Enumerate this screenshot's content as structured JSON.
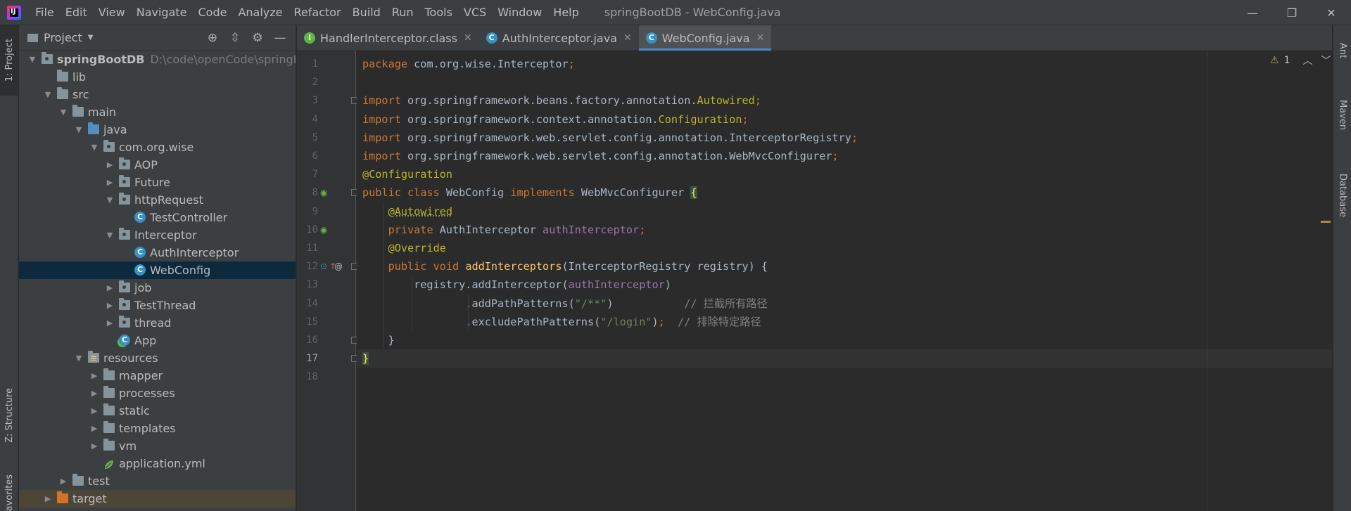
{
  "titlebar": {
    "menu": [
      "File",
      "Edit",
      "View",
      "Navigate",
      "Code",
      "Analyze",
      "Refactor",
      "Build",
      "Run",
      "Tools",
      "VCS",
      "Window",
      "Help"
    ],
    "window_title": "springBootDB - WebConfig.java",
    "minimize": "—",
    "restore": "❐",
    "close": "✕"
  },
  "left_strip": {
    "project_tab": "1: Project",
    "structure_tab": "Z: Structure",
    "favorites_tab": "avorites"
  },
  "right_strip": {
    "ant_tab": "Ant",
    "maven_tab": "Maven",
    "database_tab": "Database"
  },
  "project_panel": {
    "title": "Project",
    "tree": [
      {
        "label": "springBootDB",
        "path": "D:\\code\\openCode\\springBoot",
        "depth": 0,
        "expanded": true,
        "icon": "module-folder"
      },
      {
        "label": "lib",
        "depth": 1,
        "icon": "folder"
      },
      {
        "label": "src",
        "depth": 1,
        "expanded": true,
        "icon": "folder"
      },
      {
        "label": "main",
        "depth": 2,
        "expanded": true,
        "icon": "folder"
      },
      {
        "label": "java",
        "depth": 3,
        "expanded": true,
        "icon": "source-folder"
      },
      {
        "label": "com.org.wise",
        "depth": 4,
        "expanded": true,
        "icon": "package"
      },
      {
        "label": "AOP",
        "depth": 5,
        "expanded": false,
        "icon": "package"
      },
      {
        "label": "Future",
        "depth": 5,
        "expanded": false,
        "icon": "package"
      },
      {
        "label": "httpRequest",
        "depth": 5,
        "expanded": true,
        "icon": "package"
      },
      {
        "label": "TestController",
        "depth": 6,
        "icon": "class"
      },
      {
        "label": "Interceptor",
        "depth": 5,
        "expanded": true,
        "icon": "package"
      },
      {
        "label": "AuthInterceptor",
        "depth": 6,
        "icon": "class"
      },
      {
        "label": "WebConfig",
        "depth": 6,
        "icon": "class",
        "selected": true
      },
      {
        "label": "job",
        "depth": 5,
        "expanded": false,
        "icon": "package"
      },
      {
        "label": "TestThread",
        "depth": 5,
        "expanded": false,
        "icon": "package"
      },
      {
        "label": "thread",
        "depth": 5,
        "expanded": false,
        "icon": "package"
      },
      {
        "label": "App",
        "depth": 5,
        "icon": "spring-class"
      },
      {
        "label": "resources",
        "depth": 3,
        "expanded": true,
        "icon": "resources-folder"
      },
      {
        "label": "mapper",
        "depth": 4,
        "expanded": false,
        "icon": "folder"
      },
      {
        "label": "processes",
        "depth": 4,
        "expanded": false,
        "icon": "folder"
      },
      {
        "label": "static",
        "depth": 4,
        "expanded": false,
        "icon": "folder"
      },
      {
        "label": "templates",
        "depth": 4,
        "expanded": false,
        "icon": "folder"
      },
      {
        "label": "vm",
        "depth": 4,
        "expanded": false,
        "icon": "folder"
      },
      {
        "label": "application.yml",
        "depth": 4,
        "icon": "yml-file"
      },
      {
        "label": "test",
        "depth": 2,
        "expanded": false,
        "icon": "folder"
      },
      {
        "label": "target",
        "depth": 1,
        "expanded": false,
        "icon": "excluded-folder",
        "excluded": true
      }
    ]
  },
  "editor": {
    "tabs": [
      {
        "label": "HandlerInterceptor.class",
        "icon": "interface-icon",
        "active": false
      },
      {
        "label": "AuthInterceptor.java",
        "icon": "class-icon",
        "active": false
      },
      {
        "label": "WebConfig.java",
        "icon": "class-icon",
        "active": true
      }
    ],
    "tab_close": "✕",
    "current_line": 17,
    "inspection": {
      "warning_icon": "⚠",
      "count": "1",
      "up": "︿",
      "down": "﹀"
    },
    "lines": [
      [
        [
          "kw",
          "package "
        ],
        [
          "",
          "com.org.wise.Interceptor"
        ],
        [
          "kw",
          ";"
        ]
      ],
      [],
      [
        [
          "kw",
          "import "
        ],
        [
          "",
          "org.springframework.beans.factory.annotation."
        ],
        [
          "an",
          "Autowired"
        ],
        [
          "kw",
          ";"
        ]
      ],
      [
        [
          "kw",
          "import "
        ],
        [
          "",
          "org.springframework.context.annotation."
        ],
        [
          "an",
          "Configuration"
        ],
        [
          "kw",
          ";"
        ]
      ],
      [
        [
          "kw",
          "import "
        ],
        [
          "",
          "org.springframework.web.servlet.config.annotation.InterceptorRegistry"
        ],
        [
          "kw",
          ";"
        ]
      ],
      [
        [
          "kw",
          "import "
        ],
        [
          "",
          "org.springframework.web.servlet.config.annotation.WebMvcConfigurer"
        ],
        [
          "kw",
          ";"
        ]
      ],
      [
        [
          "an",
          "@Configuration"
        ]
      ],
      [
        [
          "kw",
          "public class "
        ],
        [
          "",
          "WebConfig "
        ],
        [
          "kw",
          "implements "
        ],
        [
          "",
          "WebMvcConfigurer "
        ],
        [
          "br",
          "{"
        ]
      ],
      [
        [
          "",
          "    "
        ],
        [
          "an",
          "@Autowired"
        ]
      ],
      [
        [
          "",
          "    "
        ],
        [
          "kw",
          "private "
        ],
        [
          "",
          "AuthInterceptor "
        ],
        [
          "fd",
          "authInterceptor"
        ],
        [
          "kw",
          ";"
        ]
      ],
      [
        [
          "",
          "    "
        ],
        [
          "an",
          "@Override"
        ]
      ],
      [
        [
          "",
          "    "
        ],
        [
          "kw",
          "public void "
        ],
        [
          "fn",
          "addInterceptors"
        ],
        [
          "",
          "(InterceptorRegistry registry) {"
        ]
      ],
      [
        [
          "",
          "        registry.addInterceptor("
        ],
        [
          "fd",
          "authInterceptor"
        ],
        [
          "",
          ")"
        ]
      ],
      [
        [
          "",
          "                .addPathPatterns("
        ],
        [
          "st",
          "\"/**\""
        ],
        [
          "",
          ")           "
        ],
        [
          "cm",
          "// 拦截所有路径"
        ]
      ],
      [
        [
          "",
          "                .excludePathPatterns("
        ],
        [
          "st",
          "\"/login\""
        ],
        [
          "",
          ")"
        ],
        [
          "kw",
          ";"
        ],
        [
          "",
          "  "
        ],
        [
          "cm",
          "// 排除特定路径"
        ]
      ],
      [
        [
          "",
          "    }"
        ]
      ],
      [
        [
          "br",
          "}"
        ]
      ],
      []
    ]
  }
}
